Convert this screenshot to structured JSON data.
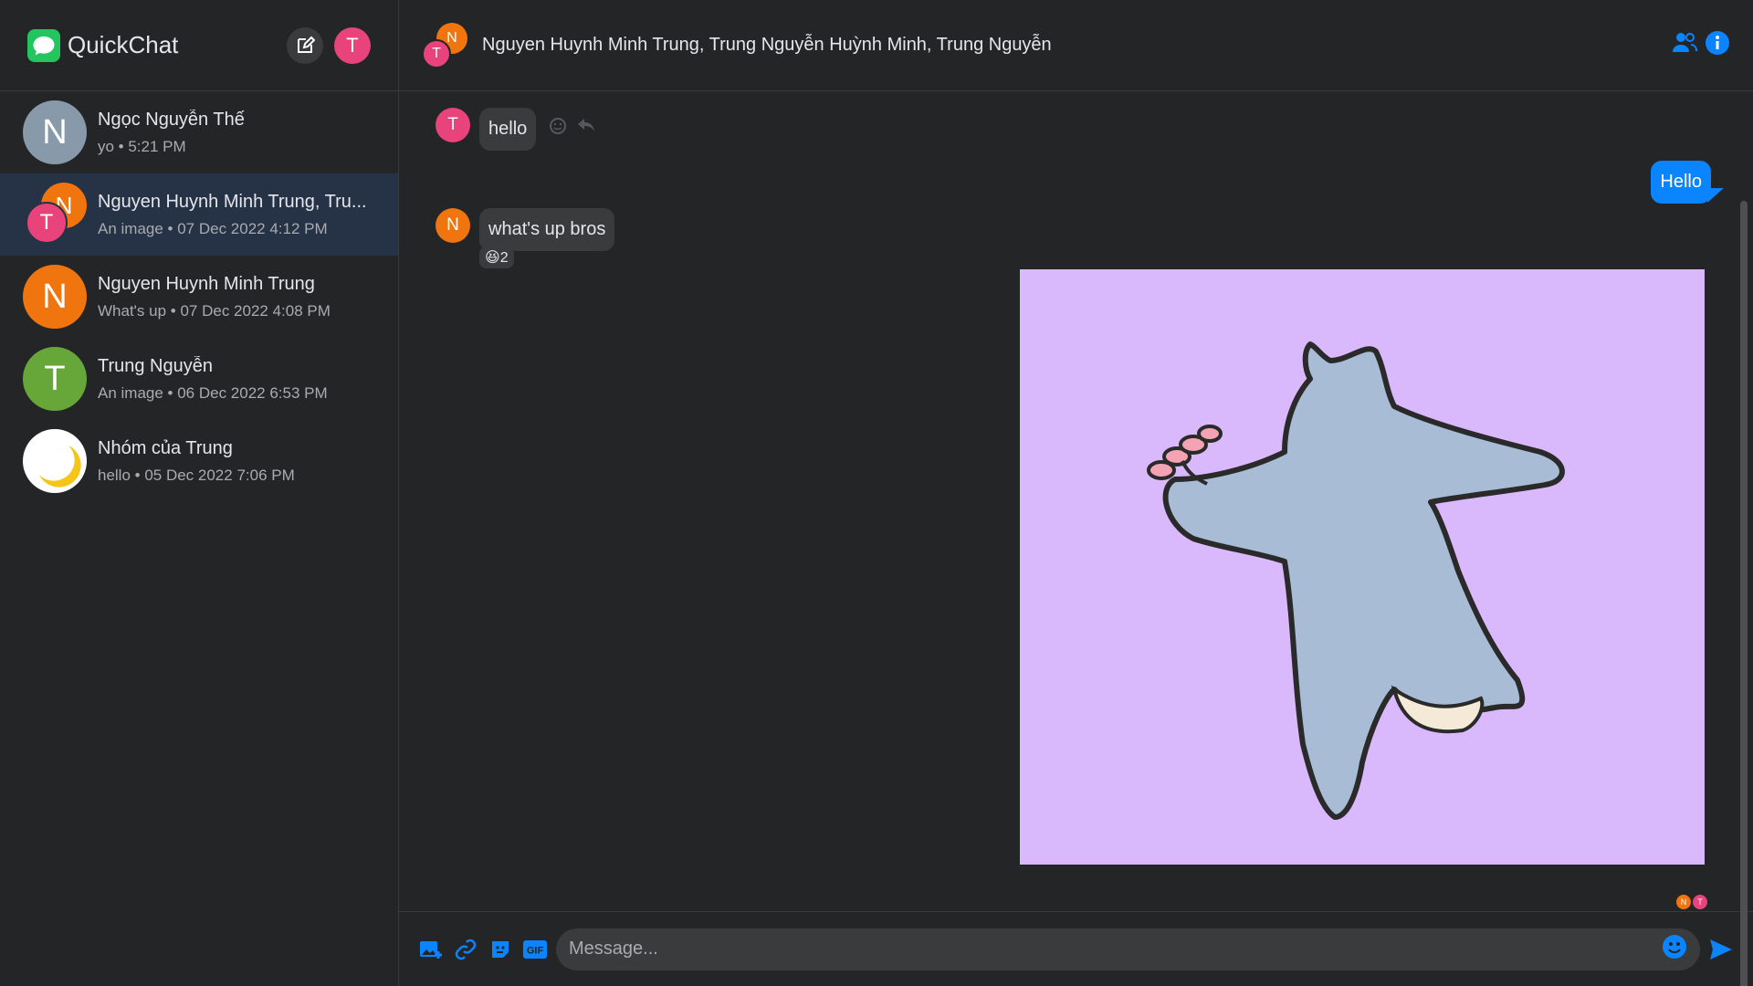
{
  "app": {
    "name": "QuickChat",
    "me_initial": "T"
  },
  "colors": {
    "accent": "#0a84ff",
    "sidebar_active": "#263245",
    "bubble_in": "#3a3b3c"
  },
  "conversations": [
    {
      "name": "Ngọc Nguyễn Thế",
      "sub": "yo • 5:21 PM",
      "initial": "N",
      "color": "#8899aa"
    },
    {
      "name": "Nguyen Huynh Minh Trung, Tru...",
      "sub": "An image • 07 Dec 2022 4:12 PM",
      "initial_1": "N",
      "initial_2": "T",
      "active": true
    },
    {
      "name": "Nguyen Huynh Minh Trung",
      "sub": "What's up • 07 Dec 2022 4:08 PM",
      "initial": "N",
      "color": "#f0750f"
    },
    {
      "name": "Trung Nguyễn",
      "sub": "An image • 06 Dec 2022 6:53 PM",
      "initial": "T",
      "color": "#67a638"
    },
    {
      "name": "Nhóm của Trung",
      "sub": "hello • 05 Dec 2022 7:06 PM",
      "icon": "moon-icon"
    }
  ],
  "header": {
    "title": "Nguyen Huynh Minh Trung, Trung Nguyễn Huỳnh Minh, Trung Nguyễn",
    "initial_1": "N",
    "initial_2": "T"
  },
  "messages": [
    {
      "from": "T",
      "text": "hello"
    },
    {
      "from": "me",
      "text": "Hello"
    },
    {
      "from": "N",
      "text": "what's up bros",
      "reaction": "2"
    }
  ],
  "seen_by": [
    "N",
    "T"
  ],
  "composer": {
    "placeholder": "Message..."
  }
}
